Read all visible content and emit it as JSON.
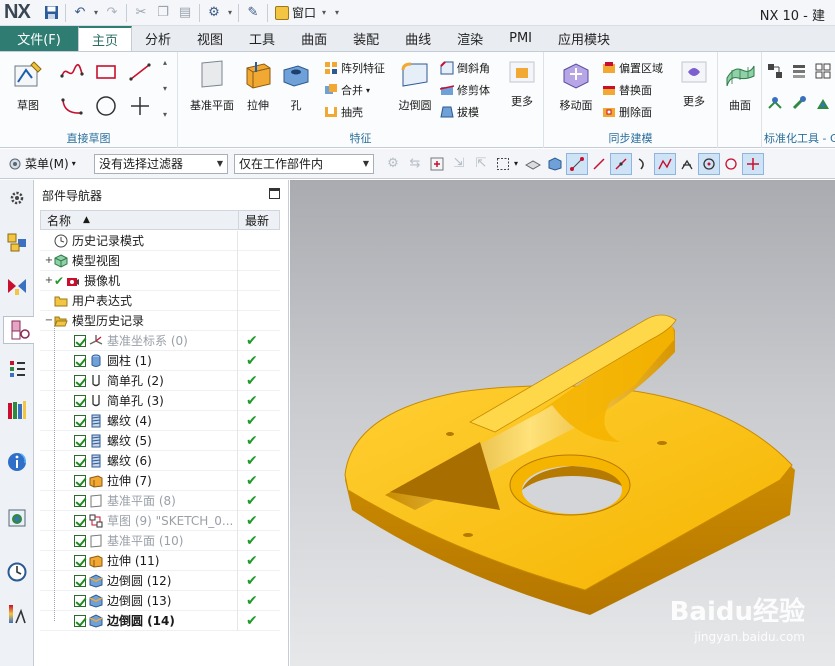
{
  "titlebar": {
    "logo": "NX",
    "window_menu_label": "窗口",
    "app_title": "NX 10 - 建"
  },
  "tabs": {
    "file": "文件(F)",
    "items": [
      "主页",
      "分析",
      "视图",
      "工具",
      "曲面",
      "装配",
      "曲线",
      "渲染",
      "PMI",
      "应用模块"
    ],
    "active_index": 0
  },
  "ribbon": {
    "sketch": {
      "big_label": "草图",
      "group_label": "直接草图"
    },
    "feature": {
      "group_label": "特征",
      "datum_plane": "基准平面",
      "extrude": "拉伸",
      "hole": "孔",
      "pattern_feature": "阵列特征",
      "unite": "合并",
      "shell": "抽壳",
      "edge_blend": "边倒圆",
      "chamfer": "倒斜角",
      "trim_body": "修剪体",
      "draft": "拔模",
      "more": "更多"
    },
    "sync": {
      "group_label": "同步建模",
      "move_face": "移动面",
      "offset_region": "偏置区域",
      "replace_face": "替换面",
      "delete_face": "删除面",
      "more": "更多"
    },
    "surface": {
      "label": "曲面"
    },
    "standard": {
      "group_label": "标准化工具 - G"
    }
  },
  "cmdbar": {
    "menu_label": "菜单(M)",
    "filter_value": "没有选择过滤器",
    "scope_value": "仅在工作部件内"
  },
  "navigator": {
    "title": "部件导航器",
    "col_name": "名称",
    "col_latest": "最新",
    "rows": [
      {
        "label": "历史记录模式",
        "level": 0,
        "icon": "clock-icon",
        "expander": "",
        "checkbox": false,
        "tick": false,
        "style": "normal"
      },
      {
        "label": "模型视图",
        "level": 0,
        "icon": "model-views-icon",
        "expander": "+",
        "checkbox": false,
        "tick": false,
        "style": "normal"
      },
      {
        "label": "摄像机",
        "level": 0,
        "icon": "camera-icon",
        "expander": "+",
        "checkbox": false,
        "tick": false,
        "style": "normal",
        "check_mark": true
      },
      {
        "label": "用户表达式",
        "level": 0,
        "icon": "folder-icon",
        "expander": "",
        "checkbox": false,
        "tick": false,
        "style": "normal"
      },
      {
        "label": "模型历史记录",
        "level": 0,
        "icon": "folder-open-icon",
        "expander": "−",
        "checkbox": false,
        "tick": false,
        "style": "normal"
      },
      {
        "label": "基准坐标系 (0)",
        "level": 1,
        "icon": "datum-csys-icon",
        "expander": "",
        "checkbox": true,
        "tick": true,
        "style": "gray"
      },
      {
        "label": "圆柱 (1)",
        "level": 1,
        "icon": "cylinder-icon",
        "expander": "",
        "checkbox": true,
        "tick": true,
        "style": "normal"
      },
      {
        "label": "简单孔 (2)",
        "level": 1,
        "icon": "hole-icon",
        "expander": "",
        "checkbox": true,
        "tick": true,
        "style": "normal"
      },
      {
        "label": "简单孔 (3)",
        "level": 1,
        "icon": "hole-icon",
        "expander": "",
        "checkbox": true,
        "tick": true,
        "style": "normal"
      },
      {
        "label": "螺纹 (4)",
        "level": 1,
        "icon": "thread-icon",
        "expander": "",
        "checkbox": true,
        "tick": true,
        "style": "normal"
      },
      {
        "label": "螺纹 (5)",
        "level": 1,
        "icon": "thread-icon",
        "expander": "",
        "checkbox": true,
        "tick": true,
        "style": "normal"
      },
      {
        "label": "螺纹 (6)",
        "level": 1,
        "icon": "thread-icon",
        "expander": "",
        "checkbox": true,
        "tick": true,
        "style": "normal"
      },
      {
        "label": "拉伸 (7)",
        "level": 1,
        "icon": "extrude-icon",
        "expander": "",
        "checkbox": true,
        "tick": true,
        "style": "normal"
      },
      {
        "label": "基准平面 (8)",
        "level": 1,
        "icon": "datum-plane-icon",
        "expander": "",
        "checkbox": true,
        "tick": true,
        "style": "gray"
      },
      {
        "label": "草图 (9) \"SKETCH_0...",
        "level": 1,
        "icon": "sketch-icon",
        "expander": "",
        "checkbox": true,
        "tick": true,
        "style": "gray"
      },
      {
        "label": "基准平面 (10)",
        "level": 1,
        "icon": "datum-plane-icon",
        "expander": "",
        "checkbox": true,
        "tick": true,
        "style": "gray"
      },
      {
        "label": "拉伸 (11)",
        "level": 1,
        "icon": "extrude-icon",
        "expander": "",
        "checkbox": true,
        "tick": true,
        "style": "normal"
      },
      {
        "label": "边倒圆 (12)",
        "level": 1,
        "icon": "edge-blend-icon",
        "expander": "",
        "checkbox": true,
        "tick": true,
        "style": "normal"
      },
      {
        "label": "边倒圆 (13)",
        "level": 1,
        "icon": "edge-blend-icon",
        "expander": "",
        "checkbox": true,
        "tick": true,
        "style": "normal"
      },
      {
        "label": "边倒圆 (14)",
        "level": 1,
        "icon": "edge-blend-icon",
        "expander": "",
        "checkbox": true,
        "tick": true,
        "style": "bold"
      }
    ],
    "tick_glyph": "✔"
  },
  "viewport": {
    "watermark_main": "Baidu经验",
    "watermark_sub": "jingyan.baidu.com"
  },
  "colors": {
    "file_tab": "#2f7c72",
    "part_yellow": "#f3b400",
    "group_label": "#2a6f9c",
    "check_green": "#1f9a2a"
  }
}
